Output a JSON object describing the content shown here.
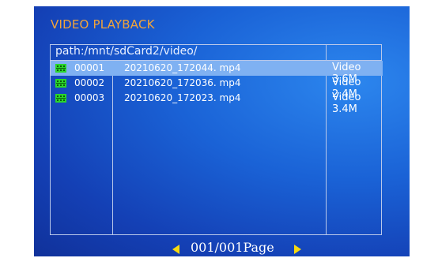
{
  "header": {
    "title": "VIDEO PLAYBACK"
  },
  "browser": {
    "path": "path:/mnt/sdCard2/video/",
    "files": [
      {
        "index": "00001",
        "name": "20210620_172044. mp4",
        "info": "Video 3.6M",
        "selected": true
      },
      {
        "index": "00002",
        "name": "20210620_172036. mp4",
        "info": "Video 2.4M",
        "selected": false
      },
      {
        "index": "00003",
        "name": "20210620_172023. mp4",
        "info": "Video 3.4M",
        "selected": false
      }
    ]
  },
  "pager": {
    "text": "001/001Page"
  },
  "icons": {
    "file": "film-icon",
    "prev": "triangle-left-icon",
    "next": "triangle-right-icon"
  },
  "colors": {
    "title": "#f2a43a",
    "selection": "#7fb1f2",
    "file_icon": "#2bd62b",
    "arrows": "#f6d90f"
  }
}
